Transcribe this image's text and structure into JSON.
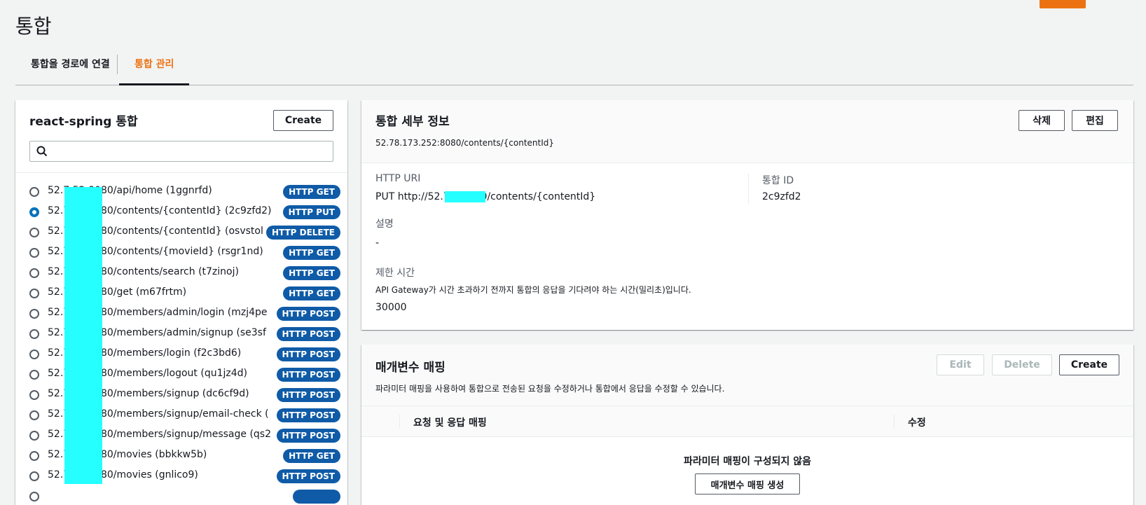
{
  "page": {
    "title": "통합"
  },
  "tabs": [
    {
      "label": "통합을 경로에 연결"
    },
    {
      "label": "통합 관리"
    }
  ],
  "left": {
    "title": "react-spring 통합",
    "create_label": "Create",
    "search_placeholder": "",
    "routes": [
      {
        "label": "52.7         52:8080/api/home (1ggnrfd)",
        "method": "HTTP GET",
        "selected": false
      },
      {
        "label": "52.7         52:8080/contents/{contentId} (2c9zfd2)",
        "method": "HTTP PUT",
        "selected": true
      },
      {
        "label": "52.7         52:8080/contents/{contentId} (osvstol",
        "method": "HTTP DELETE",
        "selected": false
      },
      {
        "label": "52.7         52:8080/contents/{movieId} (rsgr1nd)",
        "method": "HTTP GET",
        "selected": false
      },
      {
        "label": "52.7         52:8080/contents/search (t7zinoj)",
        "method": "HTTP GET",
        "selected": false
      },
      {
        "label": "52.7         52:8080/get (m67frtm)",
        "method": "HTTP GET",
        "selected": false
      },
      {
        "label": "52.7         52:8080/members/admin/login (mzj4pe",
        "method": "HTTP POST",
        "selected": false
      },
      {
        "label": "52.7         52:8080/members/admin/signup (se3sf",
        "method": "HTTP POST",
        "selected": false
      },
      {
        "label": "52.7         52:8080/members/login (f2c3bd6)",
        "method": "HTTP POST",
        "selected": false
      },
      {
        "label": "52.7         52:8080/members/logout (qu1jz4d)",
        "method": "HTTP POST",
        "selected": false
      },
      {
        "label": "52.7         52:8080/members/signup (dc6cf9d)",
        "method": "HTTP POST",
        "selected": false
      },
      {
        "label": "52.7         52:8080/members/signup/email-check (",
        "method": "HTTP POST",
        "selected": false
      },
      {
        "label": "52.7         52:8080/members/signup/message (qs2",
        "method": "HTTP POST",
        "selected": false
      },
      {
        "label": "52.7         52:8080/movies (bbkkw5b)",
        "method": "HTTP GET",
        "selected": false
      },
      {
        "label": "52.7         52:8080/movies (gnlico9)",
        "method": "HTTP POST",
        "selected": false
      },
      {
        "label": "",
        "method": "",
        "selected": false
      }
    ]
  },
  "detail": {
    "title": "통합 세부 정보",
    "subtitle": "52.78.173.252:8080/contents/{contentId}",
    "delete_label": "삭제",
    "edit_label": "편집",
    "uri_label": "HTTP URI",
    "uri_value": "PUT http://52.7            2:8080/contents/{contentId}",
    "id_label": "통합 ID",
    "id_value": "2c9zfd2",
    "desc_label": "설명",
    "desc_value": "-",
    "timeout_label": "제한 시간",
    "timeout_desc": "API Gateway가 시간 초과하기 전까지 통합의 응답을 기다려야 하는 시간(밀리초)입니다.",
    "timeout_value": "30000"
  },
  "params": {
    "title": "매개변수 매핑",
    "subtitle": "파라미터 매핑을 사용하여 통합으로 전송된 요청을 수정하거나 통합에서 응답을 수정할 수 있습니다.",
    "edit_label": "Edit",
    "delete_label": "Delete",
    "create_label": "Create",
    "col_mapping": "요청 및 응답 매핑",
    "col_modify": "수정",
    "empty_text": "파라미터 매핑이 구성되지 않음",
    "create_mapping_label": "매개변수 매핑 생성"
  },
  "colors": {
    "accent": "#ec7211",
    "badge": "#0f5ba7",
    "radio_selected": "#0073bb",
    "redaction": "#25ffff"
  }
}
